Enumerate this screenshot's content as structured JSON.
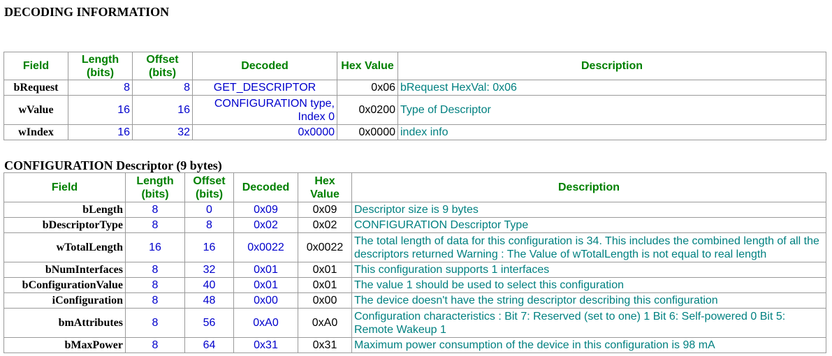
{
  "heading": "DECODING INFORMATION",
  "decode_table": {
    "headers": {
      "field": "Field",
      "length": "Length (bits)",
      "offset": "Offset (bits)",
      "decoded": "Decoded",
      "hex": "Hex Value",
      "description": "Description"
    },
    "rows": [
      {
        "field": "bRequest",
        "length": "8",
        "offset": "8",
        "decoded": "GET_DESCRIPTOR",
        "hex": "0x06",
        "description": "bRequest HexVal: 0x06"
      },
      {
        "field": "wValue",
        "length": "16",
        "offset": "16",
        "decoded": "CONFIGURATION type, Index 0",
        "hex": "0x0200",
        "description": "Type of Descriptor"
      },
      {
        "field": "wIndex",
        "length": "16",
        "offset": "32",
        "decoded": "0x0000",
        "hex": "0x0000",
        "description": "index info"
      }
    ]
  },
  "config_heading": "CONFIGURATION Descriptor (9 bytes)",
  "config_table": {
    "headers": {
      "field": "Field",
      "length": "Length (bits)",
      "offset": "Offset (bits)",
      "decoded": "Decoded",
      "hex": "Hex Value",
      "description": "Description"
    },
    "rows": [
      {
        "field": "bLength",
        "length": "8",
        "offset": "0",
        "decoded": "0x09",
        "hex": "0x09",
        "description": "Descriptor size is 9 bytes"
      },
      {
        "field": "bDescriptorType",
        "length": "8",
        "offset": "8",
        "decoded": "0x02",
        "hex": "0x02",
        "description": "CONFIGURATION Descriptor Type"
      },
      {
        "field": "wTotalLength",
        "length": "16",
        "offset": "16",
        "decoded": "0x0022",
        "hex": "0x0022",
        "description": "The total length of data for this configuration is 34. This includes the combined length of all the descriptors returned Warning : The Value of wTotalLength is not equal to real length"
      },
      {
        "field": "bNumInterfaces",
        "length": "8",
        "offset": "32",
        "decoded": "0x01",
        "hex": "0x01",
        "description": "This configuration supports 1 interfaces"
      },
      {
        "field": "bConfigurationValue",
        "length": "8",
        "offset": "40",
        "decoded": "0x01",
        "hex": "0x01",
        "description": "The value 1 should be used to select this configuration"
      },
      {
        "field": "iConfiguration",
        "length": "8",
        "offset": "48",
        "decoded": "0x00",
        "hex": "0x00",
        "description": "The device doesn't have the string descriptor describing this configuration"
      },
      {
        "field": "bmAttributes",
        "length": "8",
        "offset": "56",
        "decoded": "0xA0",
        "hex": "0xA0",
        "description": "Configuration characteristics : Bit 7: Reserved (set to one) 1 Bit 6: Self-powered 0 Bit 5: Remote Wakeup 1"
      },
      {
        "field": "bMaxPower",
        "length": "8",
        "offset": "64",
        "decoded": "0x31",
        "hex": "0x31",
        "description": "Maximum power consumption of the device in this configuration is 98 mA"
      }
    ]
  }
}
